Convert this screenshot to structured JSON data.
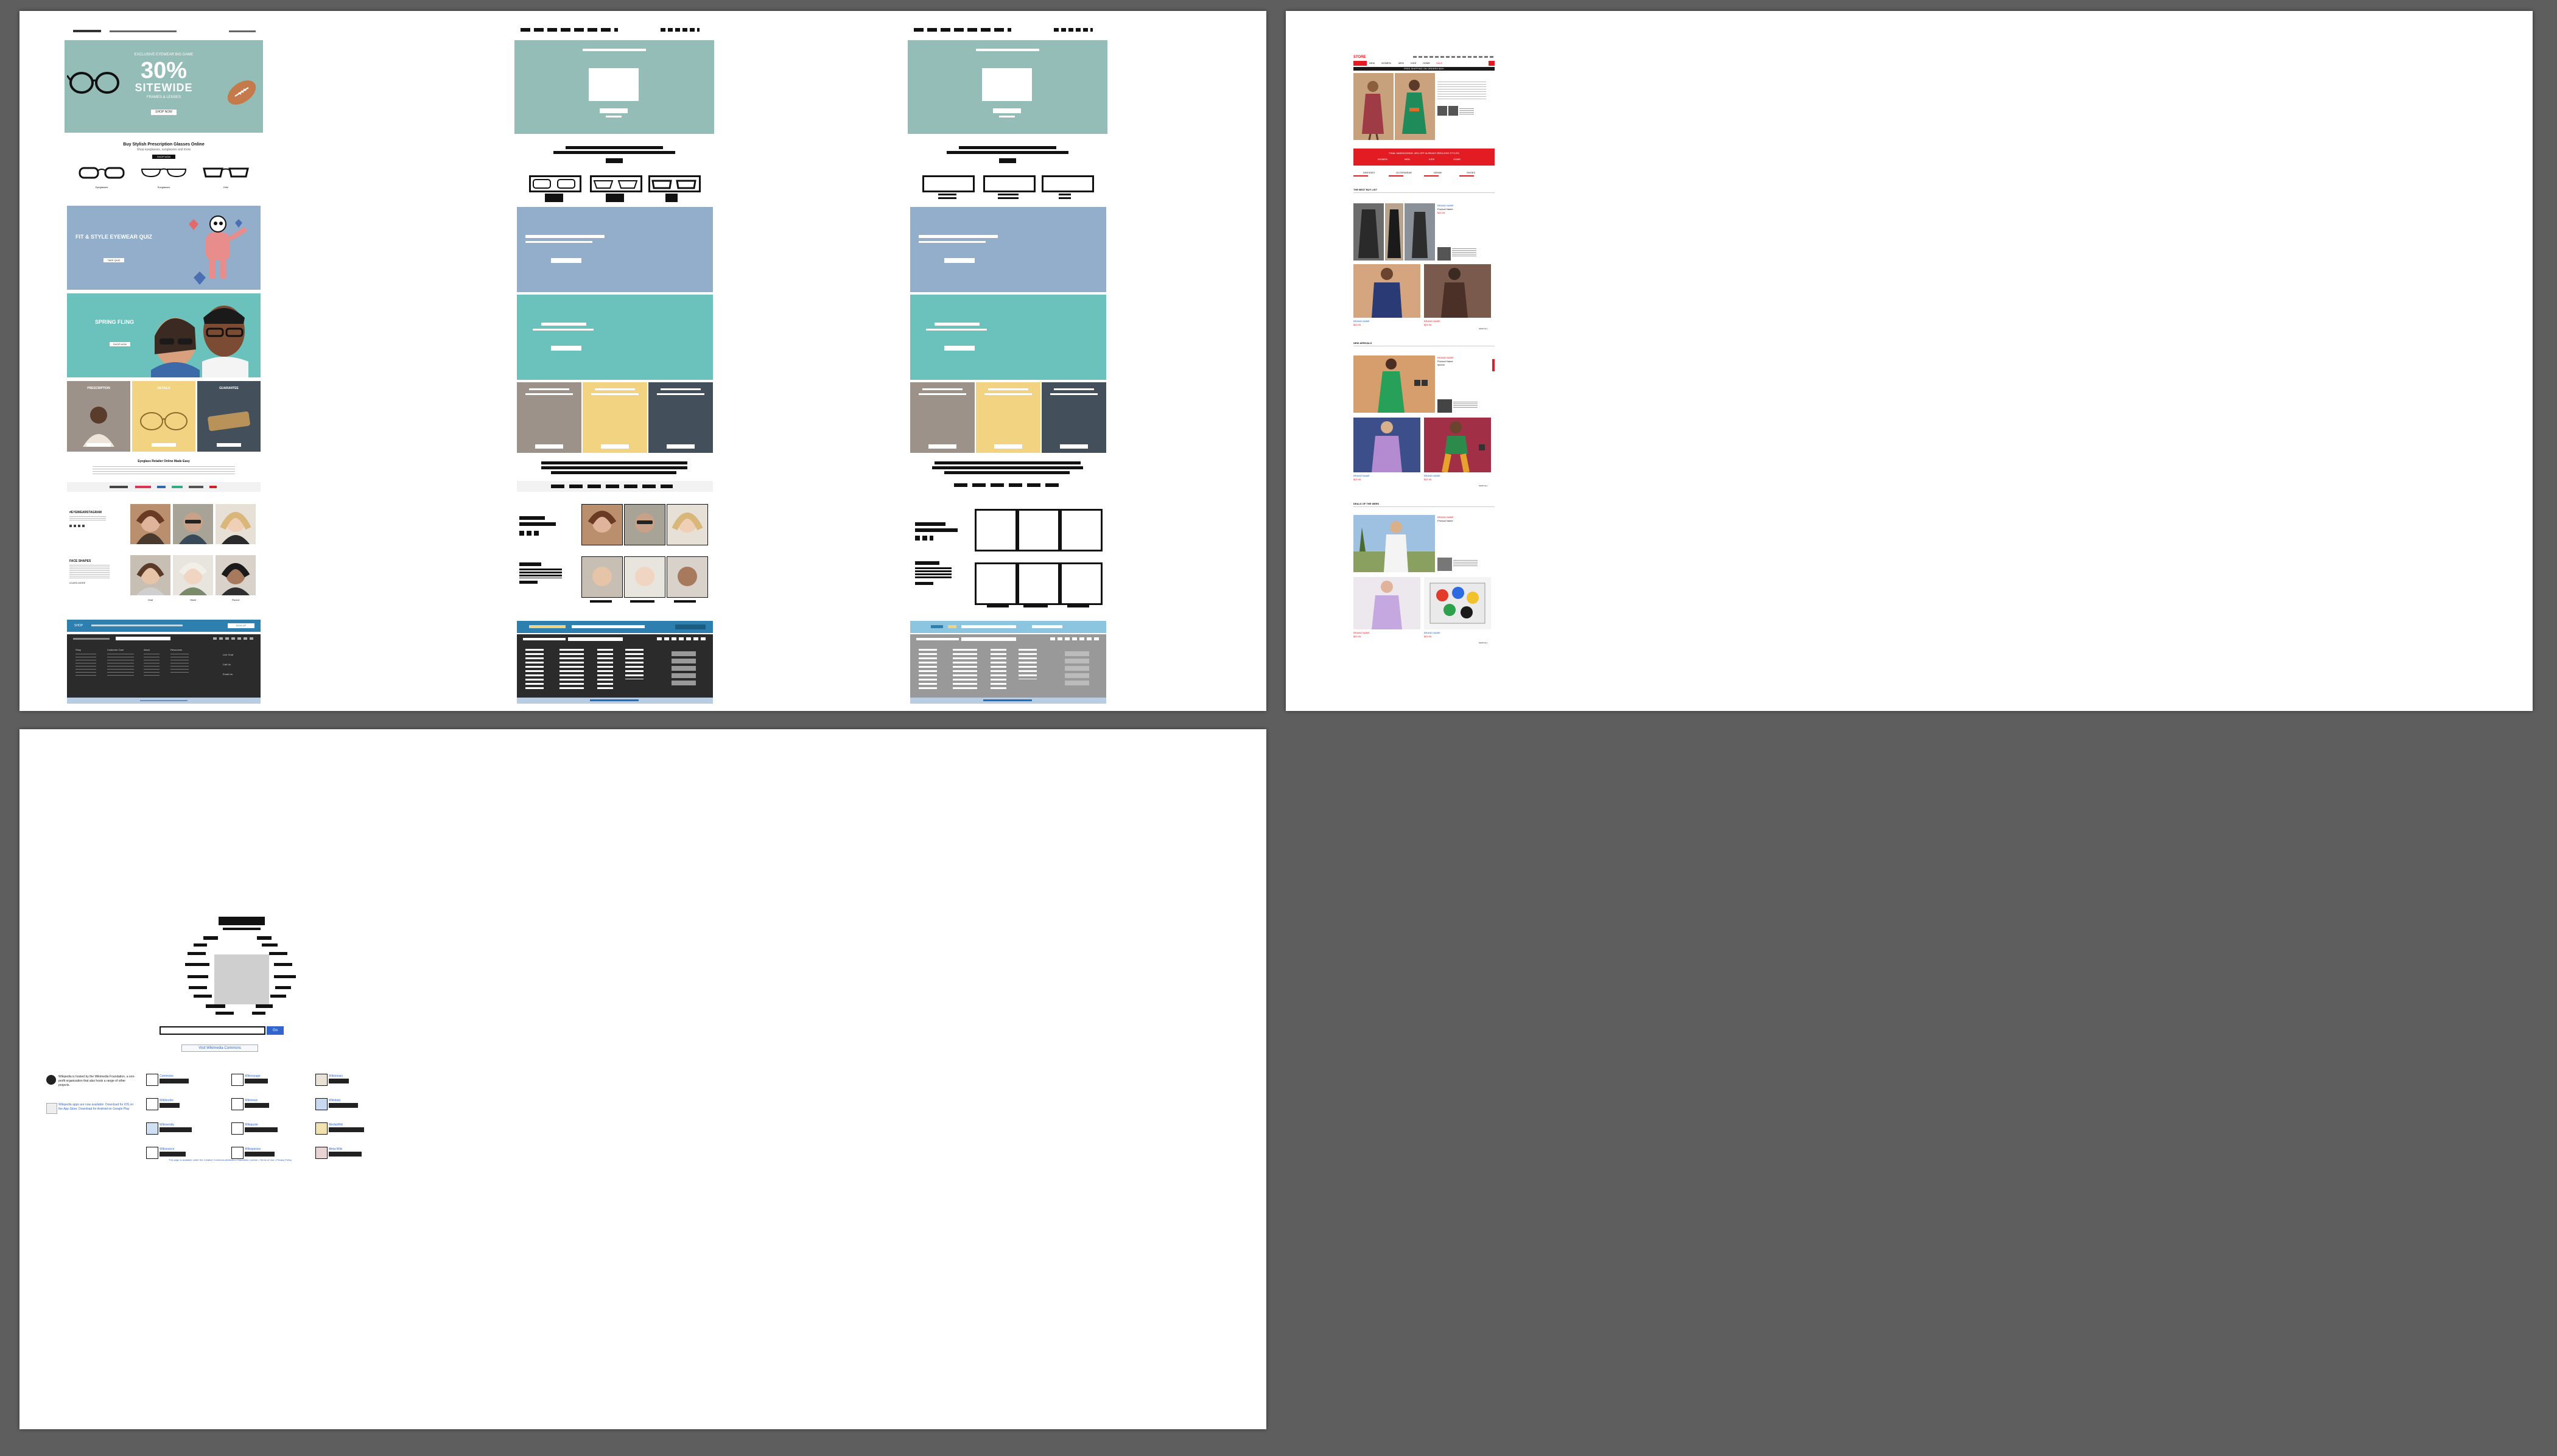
{
  "colors": {
    "desktop": "#5e5e5e",
    "hero_teal": "#93bdb6",
    "quiz_blue": "#93aecb",
    "fling_teal": "#6bc2bd",
    "card_taupe": "#9d9289",
    "card_yellow": "#f2d381",
    "card_slate": "#43505c",
    "promo_blue": "#2c7fae",
    "footer_dark": "#2b2b2b",
    "retail_red": "#e31b23",
    "link_blue": "#1f5fbf"
  },
  "eyewear": {
    "hero": {
      "eyebrow": "EXCLUSIVE EYEWEAR BIG GAME",
      "headline_pct": "30%",
      "headline_word": "SITEWIDE",
      "subline": "FRAMES & LENSES",
      "cta": "SHOP NOW"
    },
    "frames": {
      "title": "Buy Stylish Prescription Glasses Online",
      "subtitle": "Shop eyeglasses, sunglasses and more",
      "cta": "SHOP NOW",
      "labels": [
        "Eyeglasses",
        "Sunglasses",
        "Kids"
      ]
    },
    "quiz": {
      "title": "FIT & STYLE EYEWEAR QUIZ",
      "cta": "TAKE QUIZ"
    },
    "fling": {
      "title": "SPRING FLING",
      "cta": "SHOP NOW"
    },
    "cards": [
      {
        "title": "PRESCRIPTION",
        "cta": "LEARN MORE"
      },
      {
        "title": "DETAILS",
        "cta": "LEARN MORE"
      },
      {
        "title": "GUARANTEE",
        "cta": "LEARN MORE"
      }
    ],
    "press": {
      "title": "Eyeglass Retailer Online Made Easy"
    },
    "social": {
      "title": "#EYEWEARSTAGRAM",
      "cta": "SEE MORE"
    },
    "faces": {
      "title": "FACE SHAPES",
      "cta": "LEARN MORE"
    },
    "face_captions": [
      "Oval",
      "Heart",
      "Round"
    ],
    "promo": {
      "label": "SHOP",
      "cta": "SIGN UP"
    },
    "footer_heads": [
      "Shop",
      "Customer Care",
      "About",
      "Resources"
    ],
    "footer_side": [
      "Live Chat",
      "Call Us",
      "Email Us"
    ]
  },
  "retail": {
    "header": {
      "logo": "STORE",
      "nav": [
        "NEW",
        "WOMEN",
        "MEN",
        "KIDS",
        "HOME",
        "SALE"
      ]
    },
    "notice": "FREE SHIPPING ON ORDERS $49+",
    "promo_banner": {
      "headline": "FINAL MARKDOWNS: 40% OFF ALREADY REDUCED STYLES",
      "links": [
        "WOMEN",
        "MEN",
        "KIDS",
        "HOME"
      ]
    },
    "categories": [
      "DRESSES",
      "OUTERWEAR",
      "DENIM",
      "SHOES"
    ],
    "sections": [
      "THE BEST BUY LIST",
      "NEW ARRIVALS",
      "DEALS OF THE WEEK"
    ],
    "links": [
      "SHOP ALL",
      "SHOP ALL",
      "SHOP ALL"
    ],
    "product_brand": "BRAND NAME",
    "product_name": "Product Name",
    "sale_price": "$29.99",
    "old_price": "$49.99"
  },
  "search": {
    "button": "Go",
    "secondary_button": "Visit Wikimedia Commons",
    "info_left_1": "Wikipedia is hosted by the Wikimedia Foundation, a non-profit organization that also hosts a range of other projects.",
    "info_left_2": "Wikipedia apps are now available: Download for iOS on the App Store, Download for Android on Google Play",
    "projects": [
      {
        "name": "Commons",
        "desc": "Free media collection"
      },
      {
        "name": "Wikivoyage",
        "desc": "Free travel guide"
      },
      {
        "name": "Wiktionary",
        "desc": "Free dictionary"
      },
      {
        "name": "Wikibooks",
        "desc": "Free textbooks"
      },
      {
        "name": "Wikinews",
        "desc": "Free news source"
      },
      {
        "name": "Wikidata",
        "desc": "Free knowledge base"
      },
      {
        "name": "Wikiversity",
        "desc": "Free learning resources"
      },
      {
        "name": "Wikiquote",
        "desc": "Free quote compendium"
      },
      {
        "name": "MediaWiki",
        "desc": "Free & open wiki software"
      },
      {
        "name": "Wikisource",
        "desc": "Free content library"
      },
      {
        "name": "Wikispecies",
        "desc": "Free species directory"
      },
      {
        "name": "Meta-Wiki",
        "desc": "Community coordination"
      }
    ],
    "footer": "This page is available under the Creative Commons Attribution-ShareAlike License • Terms of Use • Privacy Policy"
  }
}
